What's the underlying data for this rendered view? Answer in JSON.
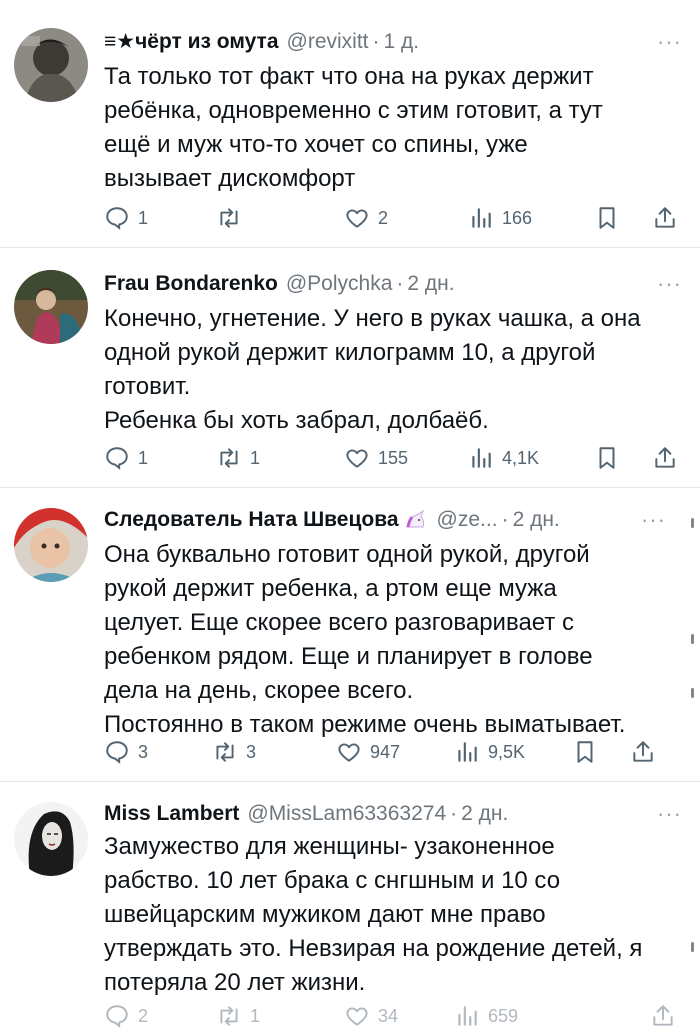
{
  "tweets": [
    {
      "name": "≡★чёрт из омута",
      "handle": "@revixitt",
      "time": "1 д.",
      "more": "···",
      "lines": [
        "Та только тот факт что она на руках держит",
        "ребёнка, одновременно с этим готовит, а тут",
        "ещё и муж что-то хочет со спины, уже",
        "вызывает дискомфорт"
      ],
      "replies": "1",
      "retweets": "",
      "likes": "2",
      "views": "166"
    },
    {
      "name": "Frau Bondarenko",
      "handle": "@Polychka",
      "time": "2 дн.",
      "more": "···",
      "lines": [
        "Конечно, угнетение. У него в руках чашка, а она",
        "одной рукой держит килограмм 10, а другой",
        "готовит.",
        "Ребенка бы хоть забрал, долбаёб."
      ],
      "replies": "1",
      "retweets": "1",
      "likes": "155",
      "views": "4,1K"
    },
    {
      "name": "Следователь Ната Швецова",
      "handle": "@ze...",
      "time": "2 дн.",
      "more": "···",
      "lines": [
        "Она буквально готовит одной рукой, другой",
        "рукой держит ребенка, а ртом еще мужа",
        "целует. Еще скорее всего разговаривает с",
        "ребенком рядом. Еще и планирует в голове",
        "дела на день, скорее всего.",
        "Постоянно в таком режиме очень выматывает."
      ],
      "replies": "3",
      "retweets": "3",
      "likes": "947",
      "views": "9,5K"
    },
    {
      "name": "Miss Lambert",
      "handle": "@MissLam63363274",
      "time": "2 дн.",
      "more": "···",
      "lines": [
        "Замужество для женщины- узаконенное",
        "рабство. 10 лет брака с снгшным и 10 со",
        "швейцарским мужиком дают мне право",
        "утверждать это. Невзирая на рождение детей, я",
        "потеряла  20  лет жизни."
      ],
      "replies": "2",
      "retweets": "1",
      "likes": "34",
      "views": "659"
    }
  ],
  "colors": {
    "text": "#0f1419",
    "muted": "#6e767d",
    "icon": "#536471",
    "divider": "#e6e6e6"
  },
  "icons": [
    "reply-icon",
    "retweet-icon",
    "like-icon",
    "views-icon",
    "bookmark-icon",
    "share-icon",
    "more-icon",
    "unicorn-emoji-icon"
  ]
}
